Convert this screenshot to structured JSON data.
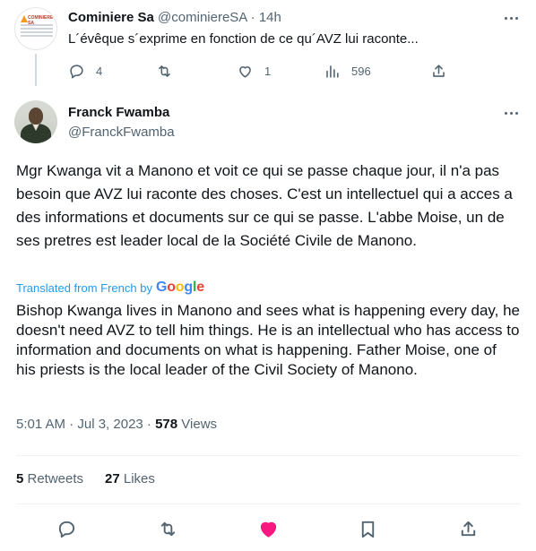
{
  "parent_tweet": {
    "avatar_logo_text": "COMINIERE SA",
    "name": "Cominiere Sa",
    "handle": "@cominiereSA",
    "separator": "·",
    "time": "14h",
    "text": "L´évêque s´exprime en fonction de ce qu´AVZ lui raconte...",
    "replies": "4",
    "likes": "1",
    "views": "596",
    "icons": [
      "reply-icon",
      "retweet-icon",
      "like-icon",
      "views-icon",
      "share-icon",
      "more-icon"
    ]
  },
  "main_tweet": {
    "name": "Franck Fwamba",
    "handle": "@FranckFwamba",
    "text": "Mgr Kwanga vit a Manono et voit ce qui se passe chaque jour, il n'a pas besoin que AVZ lui raconte des choses. C'est un intellectuel qui a acces a des informations et documents sur ce qui se passe. L'abbe Moise, un de ses pretres est leader local de la Société Civile de Manono.",
    "translated_label": "Translated from French by",
    "translator": "Google",
    "translation": "Bishop Kwanga lives in Manono and sees what is happening every day, he doesn't need AVZ to tell him things. He is an intellectual who has access to information and documents on what is happening. Father Moise, one of his priests is the local leader of the Civil Society of Manono.",
    "timestamp": "5:01 AM · Jul 3, 2023 · ",
    "views_count": "578",
    "views_label": " Views",
    "retweets_count": "5",
    "retweets_label": " Retweets",
    "likes_count": "27",
    "likes_label": " Likes",
    "liked": true,
    "like_color": "#f91880",
    "link_color": "#1d9bf0",
    "icons": [
      "reply-icon",
      "retweet-icon",
      "heart-icon",
      "bookmark-icon",
      "share-icon",
      "more-icon"
    ]
  }
}
